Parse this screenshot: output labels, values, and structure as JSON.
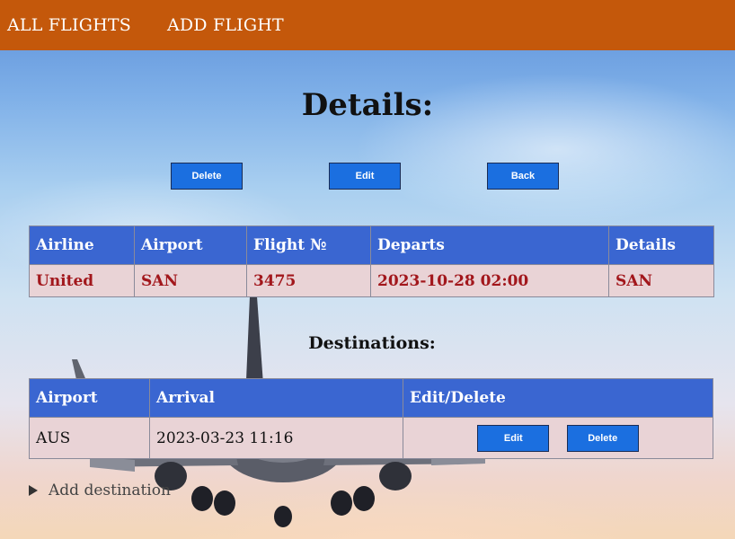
{
  "nav": {
    "all_flights": "ALL FLIGHTS",
    "add_flight": "ADD FLIGHT"
  },
  "page_title": "Details:",
  "actions": {
    "delete": "Delete",
    "edit": "Edit",
    "back": "Back"
  },
  "flight_table": {
    "headers": [
      "Airline",
      "Airport",
      "Flight №",
      "Departs",
      "Details"
    ],
    "row": [
      "United",
      "SAN",
      "3475",
      "2023-10-28 02:00",
      "SAN"
    ]
  },
  "destinations": {
    "title": "Destinations:",
    "headers": [
      "Airport",
      "Arrival",
      "Edit/Delete"
    ],
    "rows": [
      {
        "airport": "AUS",
        "arrival": "2023-03-23 11:16",
        "edit": "Edit",
        "delete": "Delete"
      }
    ]
  },
  "add_destination": "Add destination",
  "colors": {
    "navbar": "#c4580b",
    "table_header": "#3a66d1",
    "button": "#1b6fe0",
    "row_bg": "#e9d3d6",
    "flight_text": "#a2171c"
  }
}
